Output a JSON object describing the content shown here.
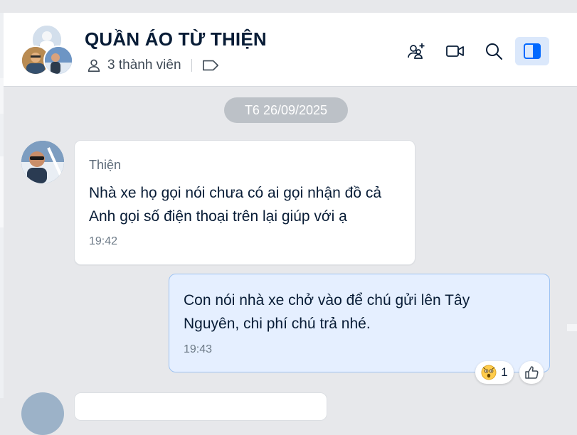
{
  "conversation": {
    "title": "QUẦN ÁO TỪ THIỆN",
    "member_count": "3 thành viên",
    "avatar_icons": [
      "group-avatar-member-1",
      "group-avatar-member-2",
      "group-avatar-member-3"
    ]
  },
  "header_actions": [
    {
      "name": "add-member",
      "icon": "add-user-icon"
    },
    {
      "name": "video-call",
      "icon": "video-camera-icon"
    },
    {
      "name": "search",
      "icon": "search-icon"
    },
    {
      "name": "toggle-info-panel",
      "icon": "side-panel-icon",
      "active": true
    }
  ],
  "date_divider": "T6 26/09/2025",
  "messages": [
    {
      "direction": "incoming",
      "sender": "Thiện",
      "lines": [
        "Nhà xe họ gọi nói chưa có ai gọi nhận đồ cả",
        "Anh gọi số điện thoại trên lại giúp với ạ"
      ],
      "time": "19:42"
    },
    {
      "direction": "outgoing",
      "lines": [
        "Con nói nhà xe chở vào để chú gửi lên Tây",
        "Nguyên, chi phí chú trả nhé."
      ],
      "time": "19:43",
      "reaction": {
        "icon": "surprised-face-emoji",
        "count": "1"
      }
    }
  ],
  "colors": {
    "accent": "#0068ff",
    "outgoing_bubble": "#e5efff",
    "outgoing_border": "#9ec3f2",
    "chat_background": "#e7e8eb",
    "date_pill": "#bcc1c7"
  }
}
